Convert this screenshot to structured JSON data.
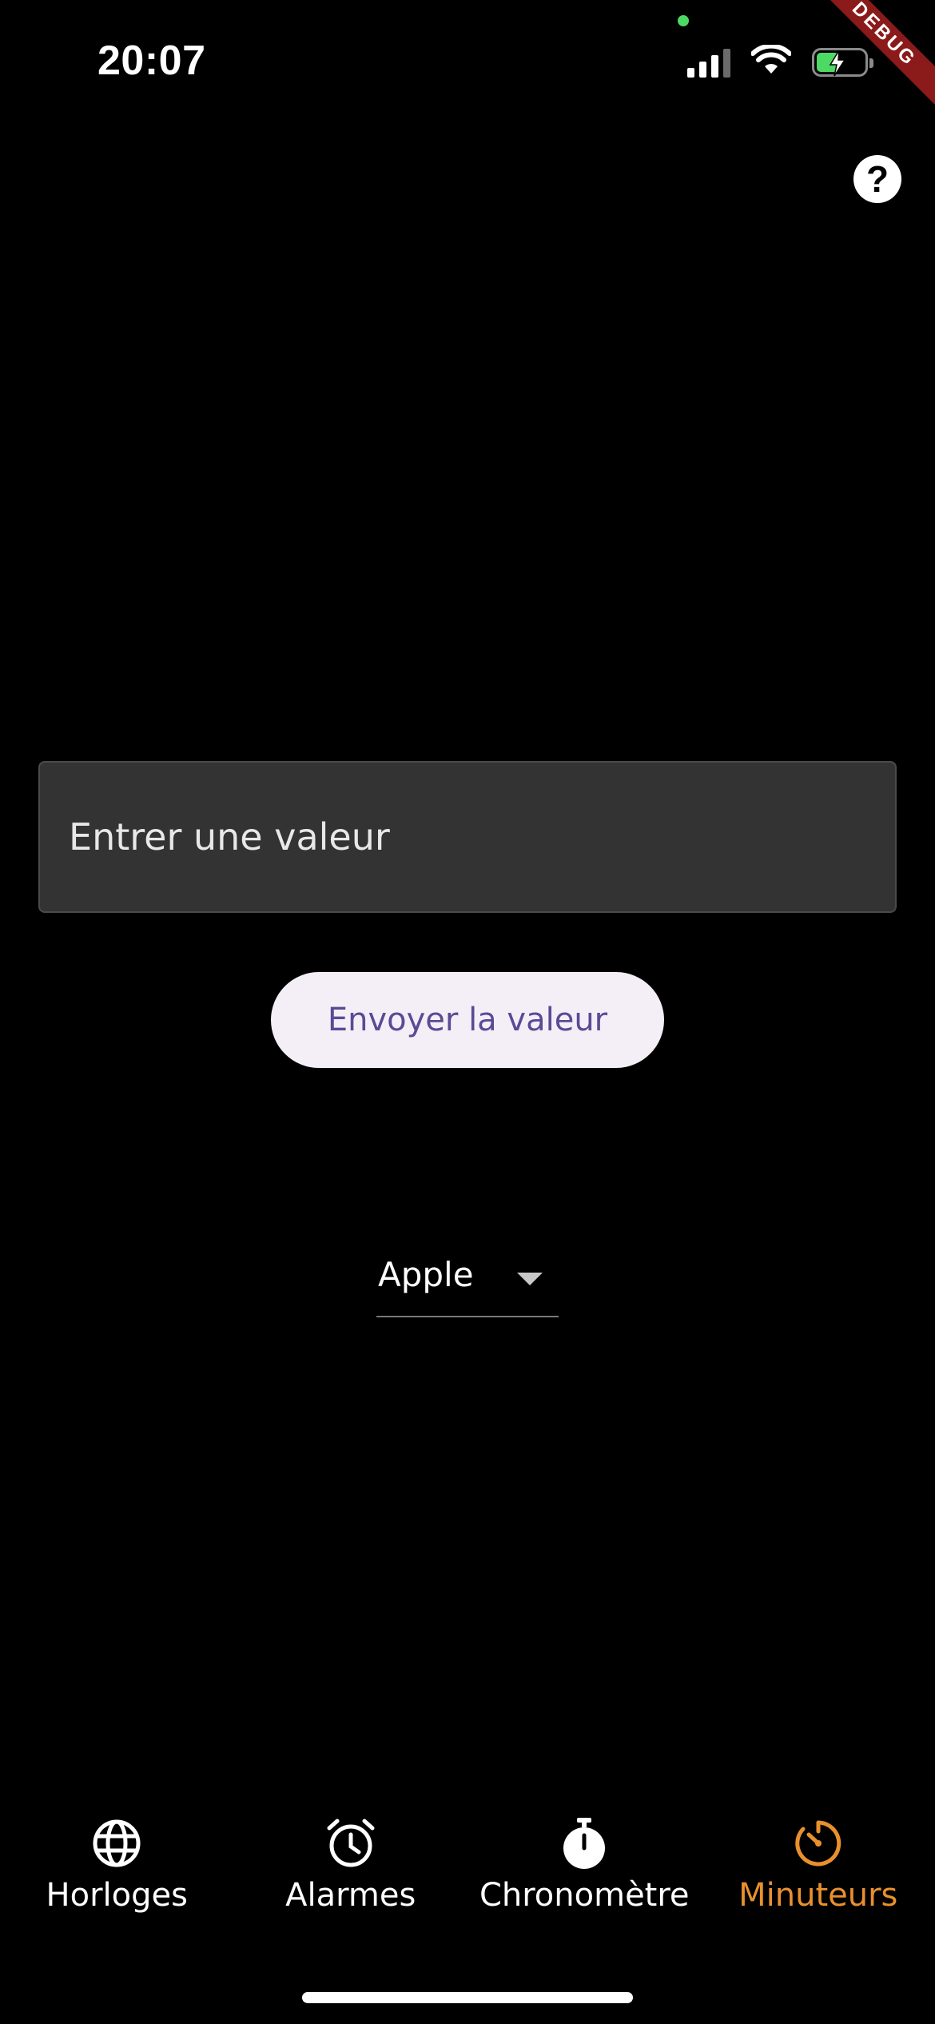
{
  "status_bar": {
    "time": "20:07",
    "icons": [
      "signal-icon",
      "wifi-icon",
      "battery-charging-icon"
    ],
    "debug_label": "DEBUG"
  },
  "header": {
    "help_icon": "question-circle-icon",
    "help_label": "?"
  },
  "form": {
    "input_placeholder": "Entrer une valeur",
    "input_value": "",
    "send_label": "Envoyer la valeur",
    "dropdown_selected": "Apple"
  },
  "bottom_nav": {
    "items": [
      {
        "label": "Horloges",
        "icon": "globe-icon",
        "active": false
      },
      {
        "label": "Alarmes",
        "icon": "alarm-clock-icon",
        "active": false
      },
      {
        "label": "Chronomètre",
        "icon": "stopwatch-icon",
        "active": false
      },
      {
        "label": "Minuteurs",
        "icon": "timer-icon",
        "active": true
      }
    ]
  },
  "colors": {
    "background": "#000000",
    "input_fill": "#333333",
    "button_fill": "#f4eff6",
    "button_text": "#5a4a96",
    "active_tab": "#e8902e",
    "debug_banner": "#8b1a1a"
  }
}
